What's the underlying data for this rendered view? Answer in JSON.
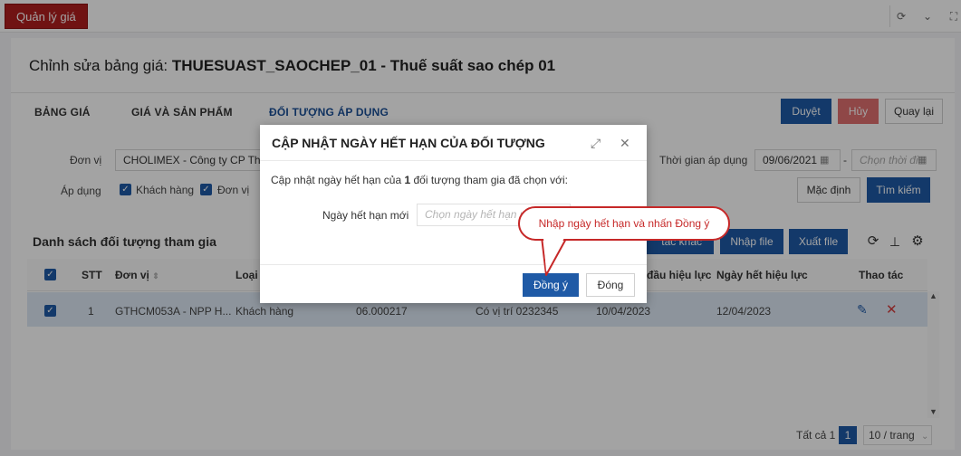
{
  "app": {
    "tab_label": "Quản lý giá"
  },
  "page": {
    "title_prefix": "Chỉnh sửa bảng giá:",
    "title_name": "THUESUAST_SAOCHEP_01 - Thuế suất sao chép 01"
  },
  "tabs": [
    {
      "label": "BẢNG GIÁ"
    },
    {
      "label": "GIÁ VÀ SẢN PHẨM"
    },
    {
      "label": "ĐỐI TƯỢNG ÁP DỤNG",
      "active": true
    }
  ],
  "actions": {
    "approve": "Duyệt",
    "cancel": "Hủy",
    "back": "Quay lại"
  },
  "filters": {
    "unit_label": "Đơn vị",
    "unit_value": "CHOLIMEX - Công ty CP Thực",
    "apply_label": "Áp dụng",
    "apply_customer": "Khách hàng",
    "apply_unit": "Đơn vị",
    "time_label": "Thời gian áp dụng",
    "date_from": "09/06/2021",
    "date_to_placeholder": "Chọn thời đi",
    "default_btn": "Mặc định",
    "search_btn": "Tìm kiếm"
  },
  "list": {
    "title": "Danh sách đối tượng tham gia",
    "other_btn": "tác khác",
    "import_btn": "Nhập file",
    "export_btn": "Xuất file",
    "columns": [
      "STT",
      "Đơn vị",
      "Loại đ",
      "đầu hiệu lực",
      "Ngày hết hiệu lực",
      "Thao tác"
    ],
    "rows": [
      {
        "stt": "1",
        "unit": "GTHCM053A - NPP H...",
        "type": "Khách hàng",
        "code": "06.000217",
        "position": "Có vị trí 0232345",
        "start": "10/04/2023",
        "end": "12/04/2023"
      }
    ]
  },
  "pager": {
    "total": "Tất cả 1",
    "page": "1",
    "size": "10 / trang"
  },
  "modal": {
    "title": "CẬP NHẬT NGÀY HẾT HẠN CỦA ĐỐI TƯỢNG",
    "desc_before": "Cập nhật ngày hết hạn của ",
    "desc_count": "1",
    "desc_after": " đối tượng tham gia đã chọn với:",
    "field_label": "Ngày hết hạn mới",
    "field_placeholder": "Chọn ngày hết hạn m",
    "confirm": "Đồng ý",
    "close": "Đóng"
  },
  "callout": {
    "text": "Nhập ngày hết hạn và nhấn Đồng ý"
  },
  "colors": {
    "brand_red": "#b01e1e",
    "primary": "#1f5aa6",
    "callout": "#c62828"
  }
}
